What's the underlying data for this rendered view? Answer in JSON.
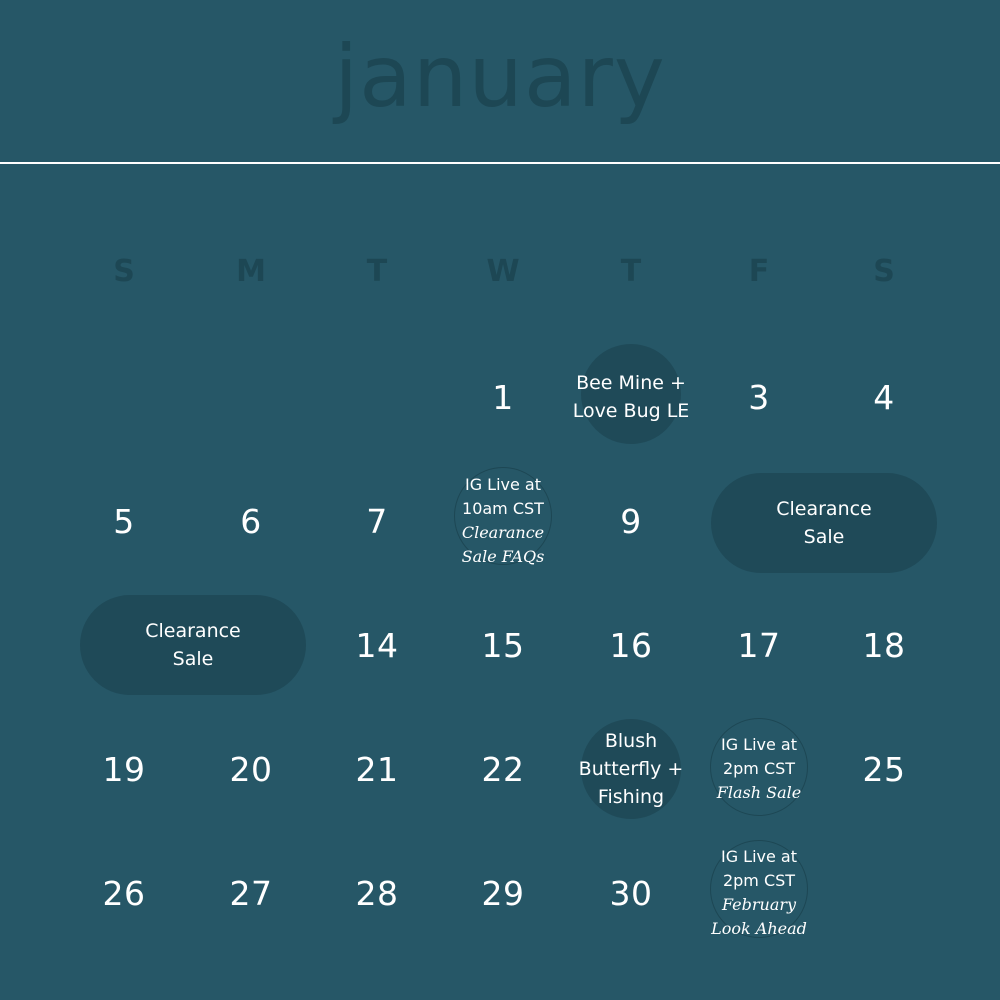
{
  "calendar": {
    "month": "january",
    "weekdays": [
      "S",
      "M",
      "T",
      "W",
      "T",
      "F",
      "S"
    ],
    "colors": {
      "background": "#265767",
      "accent_dark": "#1d4754",
      "text": "#ffffff"
    },
    "days": {
      "d1": "1",
      "d3": "3",
      "d4": "4",
      "d5": "5",
      "d6": "6",
      "d7": "7",
      "d9": "9",
      "d14": "14",
      "d15": "15",
      "d16": "16",
      "d17": "17",
      "d18": "18",
      "d19": "19",
      "d20": "20",
      "d21": "21",
      "d22": "22",
      "d25": "25",
      "d26": "26",
      "d27": "27",
      "d28": "28",
      "d29": "29",
      "d30": "30"
    },
    "events": {
      "jan2": {
        "line1": "Bee Mine +",
        "line2": "Love Bug LE"
      },
      "jan8": {
        "line1": "IG Live at",
        "line2": "10am CST",
        "line3": "Clearance",
        "line4": "Sale FAQs"
      },
      "jan10_11": {
        "line1": "Clearance",
        "line2": "Sale"
      },
      "jan12_13": {
        "line1": "Clearance",
        "line2": "Sale"
      },
      "jan23": {
        "line1": "Blush",
        "line2": "Butterfly +",
        "line3": "Fishing"
      },
      "jan24": {
        "line1": "IG Live at",
        "line2": "2pm CST",
        "line3": "Flash Sale"
      },
      "jan31": {
        "line1": "IG Live at",
        "line2": "2pm CST",
        "line3": "February",
        "line4": "Look Ahead"
      }
    }
  }
}
